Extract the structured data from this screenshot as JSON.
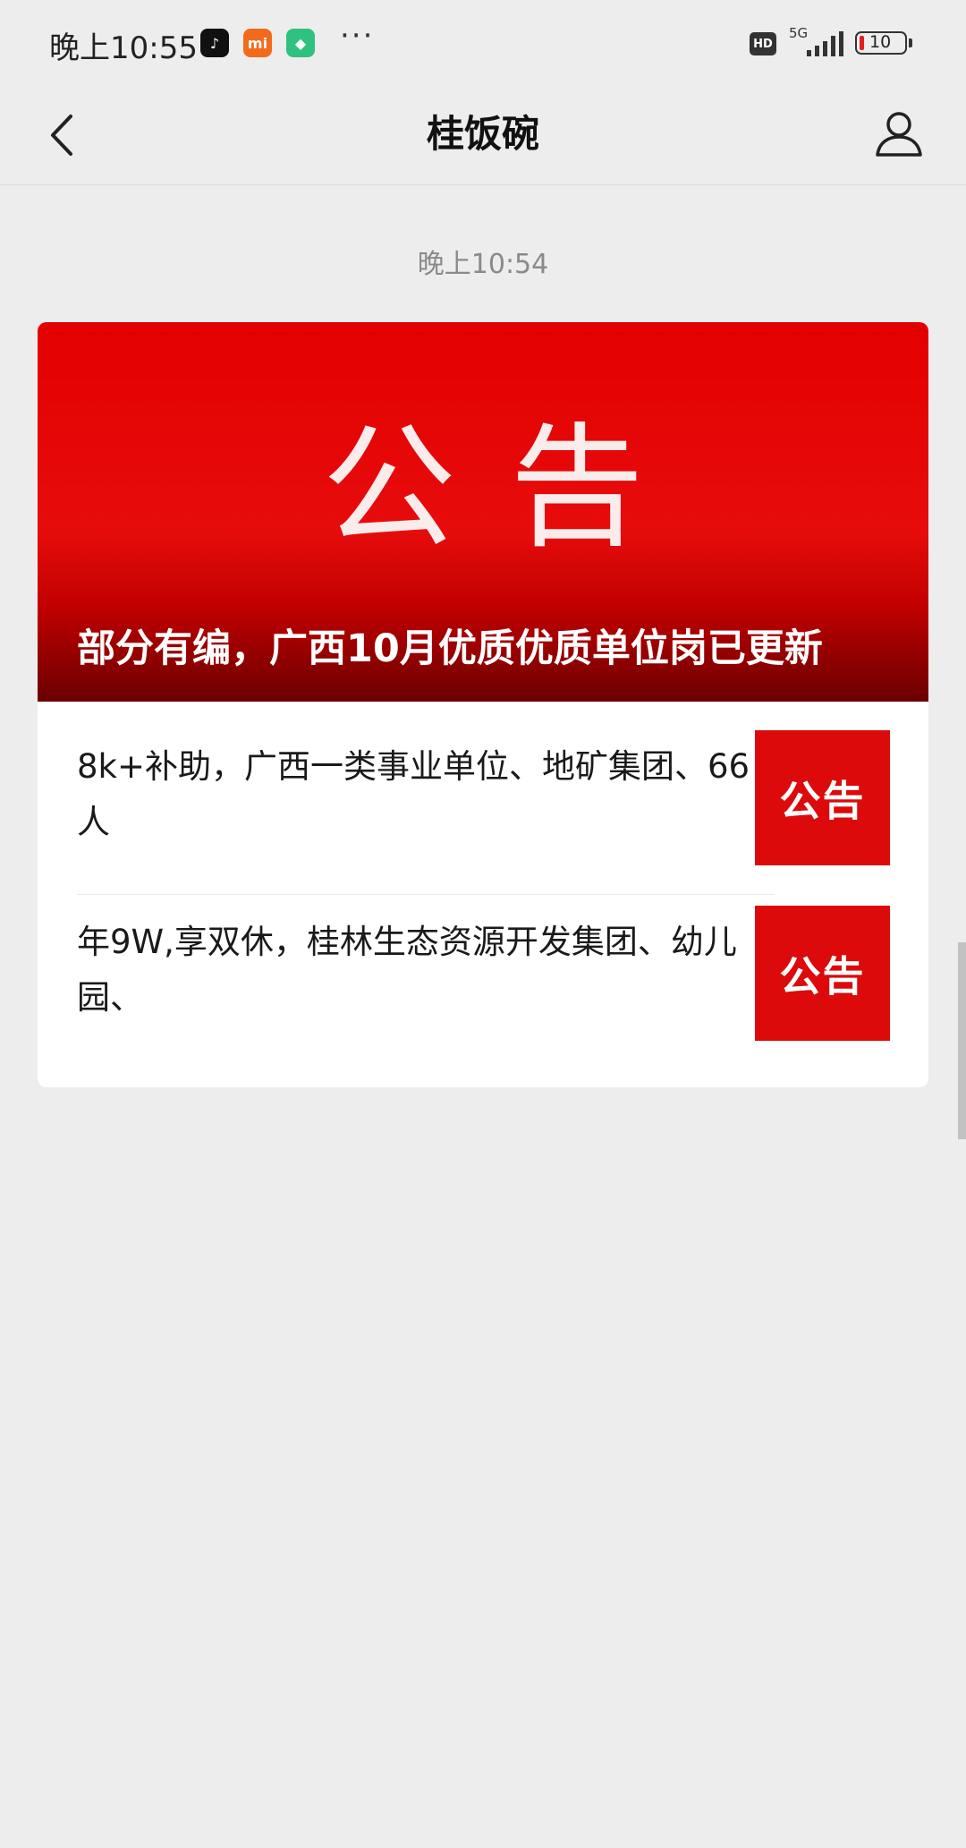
{
  "status_bar": {
    "time": "晚上10:55",
    "apps": [
      {
        "icon": "tiktok-icon",
        "label": "♪",
        "color": "#111111"
      },
      {
        "icon": "mi-icon",
        "label": "mi",
        "color": "#f26a1b"
      },
      {
        "icon": "shield-app-icon",
        "label": "◆",
        "color": "#2ec27e"
      }
    ],
    "more": "···",
    "hd": "HD",
    "network": "5G",
    "battery_level": "10"
  },
  "nav": {
    "title": "桂饭碗"
  },
  "chat": {
    "timestamp": "晚上10:54"
  },
  "article": {
    "cover_title": "公告",
    "cover_caption": "部分有编，广西10月优质优质单位岗已更新",
    "items": [
      {
        "text": "8k+补助，广西一类事业单位、地矿集团、66人",
        "thumb": "公告"
      },
      {
        "text": "年9W,享双休，桂林生态资源开发集团、幼儿园、",
        "thumb": "公告"
      }
    ]
  },
  "colors": {
    "accent_red": "#dc0a0a",
    "background": "#ededed"
  }
}
